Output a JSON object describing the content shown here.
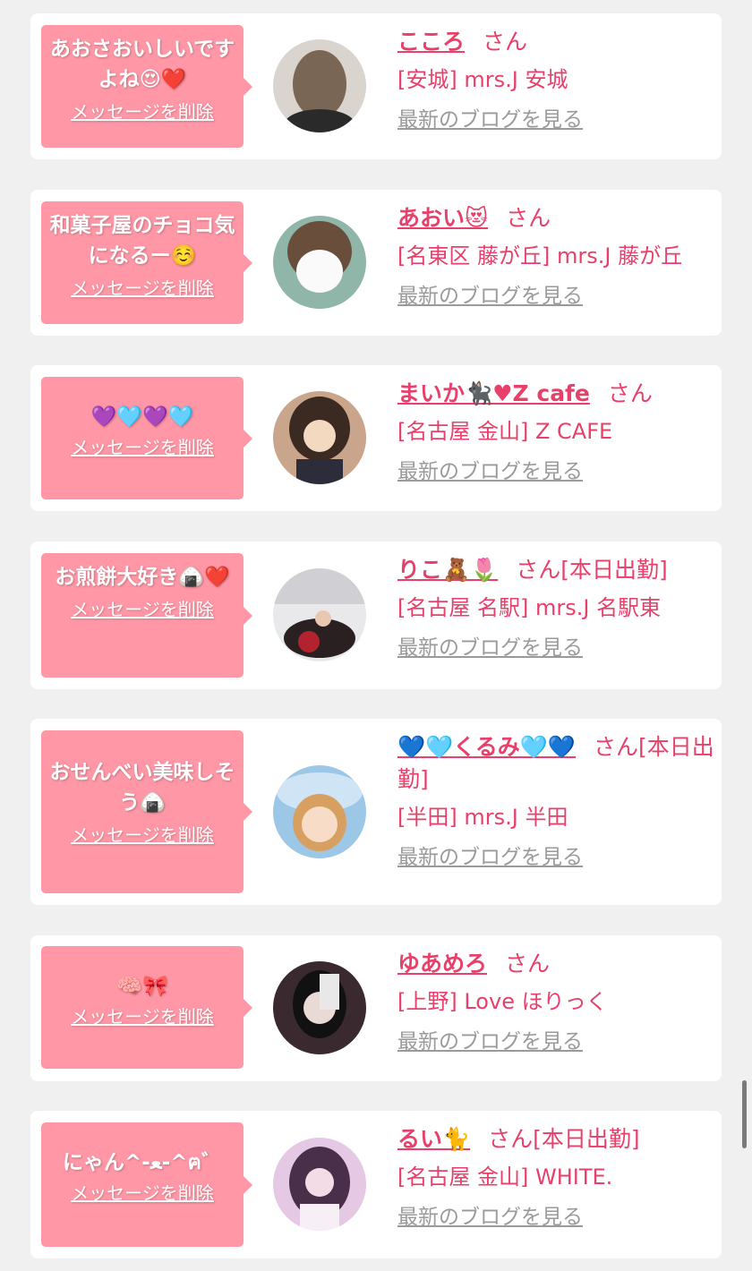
{
  "common": {
    "delete_label": "メッセージを削除",
    "blog_label": "最新のブログを見る"
  },
  "colors": {
    "page_bg": "#f0f0f0",
    "bubble": "#ff97a6",
    "accent": "#e8406a",
    "link_gray": "#9a9a9a"
  },
  "items": [
    {
      "message": "あおさおいしいですよね😍❤️",
      "name": "こころ",
      "honorific": "さん",
      "shop": "[安城] mrs.J 安城"
    },
    {
      "message": "和菓子屋のチョコ気になるー☺️",
      "name": "あおい😻",
      "honorific": "さん",
      "shop": "[名東区 藤が丘] mrs.J 藤が丘"
    },
    {
      "message": "💜🩵💜🩵",
      "name": "まいか🐈‍⬛♥Z cafe",
      "honorific": "さん",
      "shop": "[名古屋 金山] Z CAFE"
    },
    {
      "message": "お煎餅大好き🍙❤️",
      "name": "りこ🧸🌷",
      "honorific": "さん[本日出勤]",
      "shop": "[名古屋 名駅] mrs.J 名駅東"
    },
    {
      "message": "おせんべい美味しそう🍙",
      "name": "💙🩵くるみ🩵💙",
      "honorific": "さん[本日出勤]",
      "shop": "[半田] mrs.J 半田"
    },
    {
      "message": "🧠🎀",
      "name": "ゆあめろ",
      "honorific": "さん",
      "shop": "[上野] Love ほりっく"
    },
    {
      "message": "にゃん^-ﻌ-^ฅ゛",
      "name": "るい🐈",
      "honorific": "さん[本日出勤]",
      "shop": "[名古屋 金山] WHITE."
    }
  ]
}
